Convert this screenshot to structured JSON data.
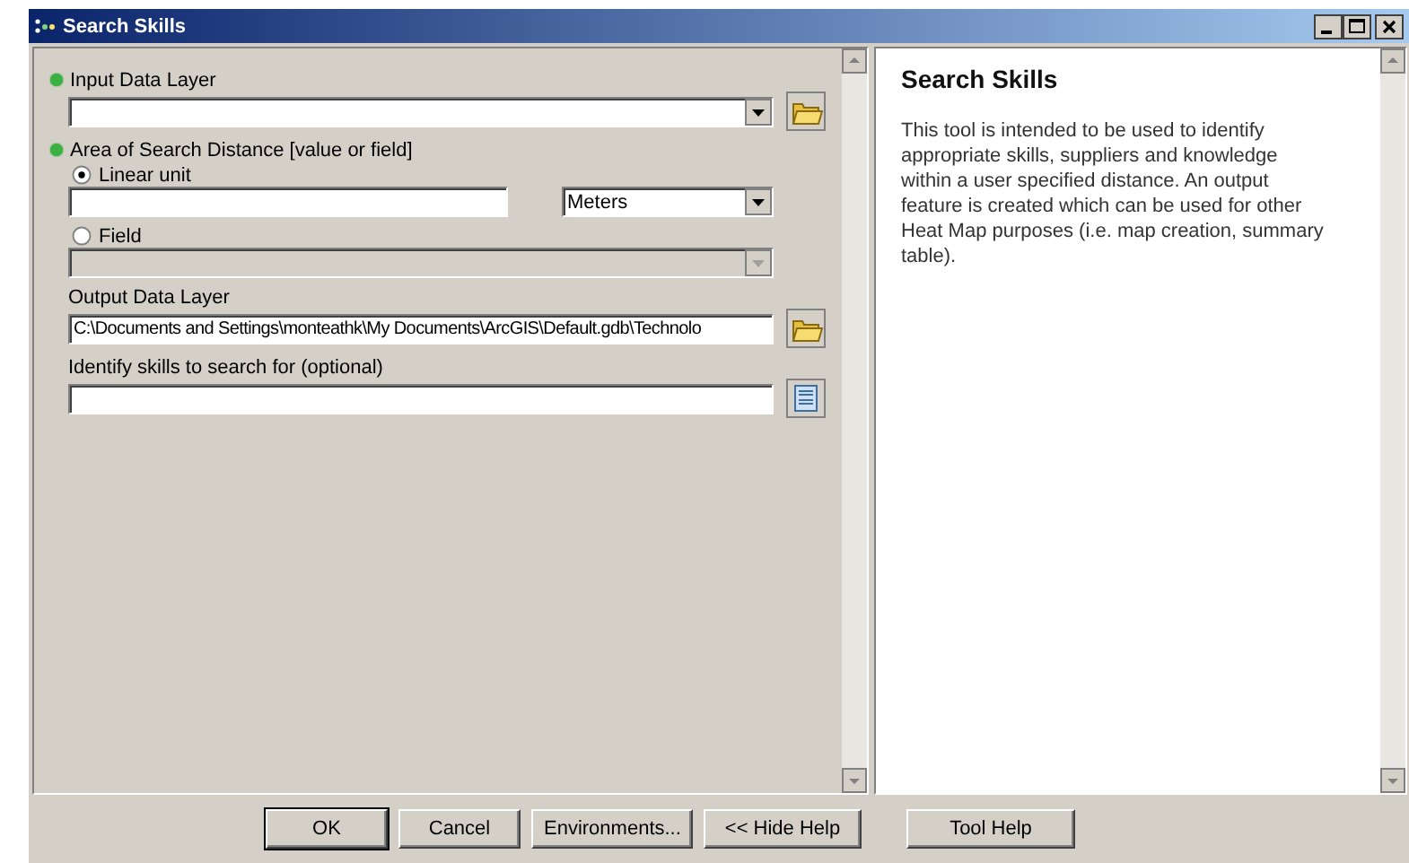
{
  "window": {
    "title": "Search Skills"
  },
  "parameters": [
    {
      "kind": "label",
      "text": "Input Data Layer",
      "required": true
    },
    {
      "kind": "combo",
      "disabled": false,
      "browse": {
        "kind": "folder"
      }
    },
    {
      "kind": "label",
      "text": "Area of Search Distance [value or field]",
      "required": true
    },
    {
      "kind": "radio",
      "text": "Linear unit",
      "selected": true
    },
    {
      "kind": "unit",
      "unit": "Meters"
    },
    {
      "kind": "radio",
      "text": "Field",
      "selected": false
    },
    {
      "kind": "combo",
      "disabled": true
    },
    {
      "kind": "label",
      "text": "Output Data Layer",
      "required": false
    },
    {
      "kind": "text",
      "value": "C:\\Documents and Settings\\monteathk\\My Documents\\ArcGIS\\Default.gdb\\Technolo",
      "browse": {
        "kind": "folder"
      }
    },
    {
      "kind": "label",
      "text": "Identify skills to search for (optional)",
      "required": false
    },
    {
      "kind": "text",
      "browse": {
        "kind": "sql"
      }
    }
  ],
  "help": {
    "title": "Search Skills",
    "body": "This tool is intended to be used to identify appropriate skills, suppliers and knowledge within a user specified distance. An output feature is created which can be used for other Heat Map purposes (i.e. map creation, summary table)."
  },
  "buttons": [
    {
      "label": "OK",
      "default": true
    },
    {
      "label": "Cancel",
      "default": false
    },
    {
      "label": "Environments...",
      "default": false
    },
    {
      "label": "<< Hide Help",
      "default": false
    }
  ],
  "help_button": {
    "label": "Tool Help"
  }
}
